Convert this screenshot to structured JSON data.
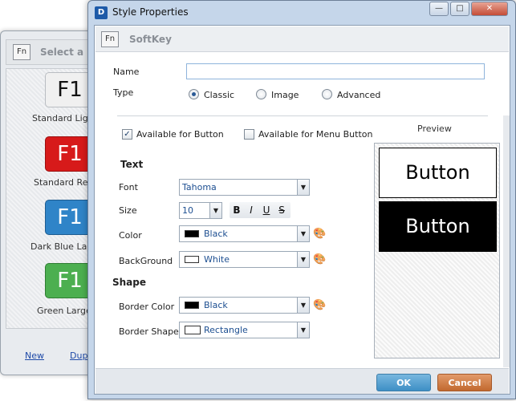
{
  "background_window": {
    "fn_icon": "Fn",
    "title": "Select a S",
    "items": [
      {
        "key": "F1",
        "label": "Standard Ligh",
        "bg": "#f0f0f0",
        "fg": "#111111"
      },
      {
        "key": "F1",
        "label": "Standard Re",
        "bg": "#d71a1a",
        "fg": "#ffffff"
      },
      {
        "key": "F1",
        "label": "Dark Blue Larg",
        "bg": "#2f84c8",
        "fg": "#ffffff"
      },
      {
        "key": "F1",
        "label": "Green Large",
        "bg": "#4caf50",
        "fg": "#ffffff"
      }
    ],
    "links": {
      "new": "New",
      "dup": "Dup"
    }
  },
  "window": {
    "title": "Style Properties",
    "app_icon": "D",
    "controls": {
      "minimize": "—",
      "maximize": "□",
      "close": "✕"
    }
  },
  "softkey": {
    "fn_icon": "Fn",
    "title": "SoftKey"
  },
  "form": {
    "name_label": "Name",
    "name_value": "",
    "type_label": "Type",
    "type_options": [
      "Classic",
      "Image",
      "Advanced"
    ],
    "type_selected": "Classic",
    "available_for_button": "Available for Button",
    "available_for_button_checked": true,
    "available_for_menu_button": "Available for Menu Button",
    "available_for_menu_button_checked": false,
    "text_section": "Text",
    "font_label": "Font",
    "font_value": "Tahoma",
    "size_label": "Size",
    "size_value": "10",
    "format_buttons": {
      "bold": "B",
      "italic": "I",
      "underline": "U",
      "strike": "S"
    },
    "color_label": "Color",
    "color_value": "Black",
    "color_swatch": "#000000",
    "background_label": "BackGround",
    "background_value": "White",
    "background_swatch": "#ffffff",
    "shape_section": "Shape",
    "border_color_label": "Border Color",
    "border_color_value": "Black",
    "border_color_swatch": "#000000",
    "border_shape_label": "Border Shape",
    "border_shape_value": "Rectangle"
  },
  "preview": {
    "title": "Preview",
    "button_text_light": "Button",
    "button_text_dark": "Button"
  },
  "actions": {
    "ok": "OK",
    "cancel": "Cancel"
  },
  "colors": {
    "ok": "#3e8fc5",
    "cancel": "#c2692f",
    "window_frame": "#c5d6ea"
  }
}
